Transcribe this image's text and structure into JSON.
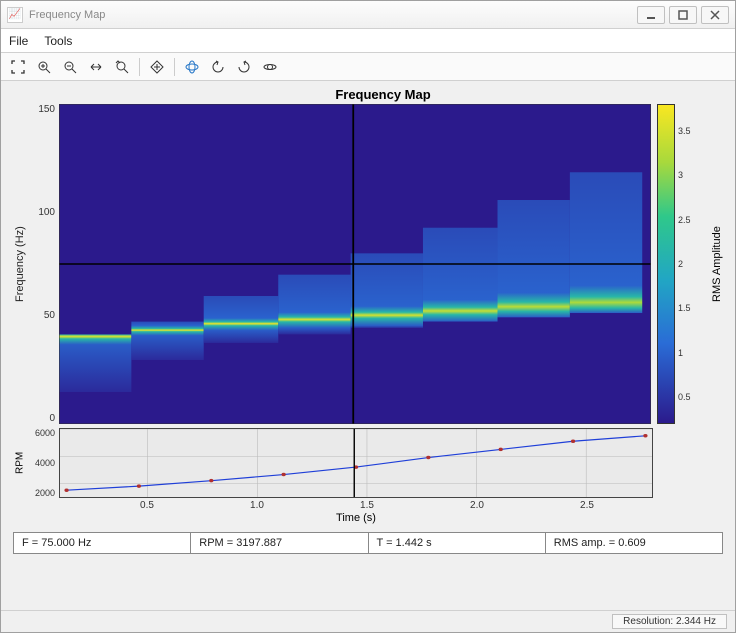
{
  "window": {
    "title": "Frequency Map",
    "min_tooltip": "Minimize",
    "max_tooltip": "Maximize",
    "close_tooltip": "Close"
  },
  "menu": {
    "file": "File",
    "tools": "Tools"
  },
  "toolbar": {
    "print": "print-icon",
    "zoom_in": "zoom-in-icon",
    "zoom_out": "zoom-out-icon",
    "pan": "pan-icon",
    "zoom_xy": "zoom-xy-icon",
    "restore": "restore-view-icon",
    "rotate3d": "rotate3d-icon",
    "go_back": "go-back-icon",
    "go_forward": "go-forward-icon",
    "link": "link-icon"
  },
  "chart_data": {
    "type": "heatmap",
    "title": "Frequency Map",
    "xlabel": "Time (s)",
    "ylabel": "Frequency (Hz)",
    "colorbar_label": "RMS Amplitude",
    "xlim": [
      0.1,
      2.8
    ],
    "ylim": [
      0,
      150
    ],
    "clim": [
      0.2,
      3.8
    ],
    "yticks": [
      0,
      50,
      100,
      150
    ],
    "colorbar_ticks": [
      0.5,
      1,
      1.5,
      2,
      2.5,
      3,
      3.5
    ],
    "crosshair": {
      "x": 1.442,
      "y": 75.0
    },
    "segments": [
      {
        "t_start": 0.1,
        "t_end": 0.43,
        "f_low": 15,
        "f_high": 42,
        "peak_f": 41,
        "peak_amp": 3.6
      },
      {
        "t_start": 0.43,
        "t_end": 0.76,
        "f_low": 30,
        "f_high": 48,
        "peak_f": 44,
        "peak_amp": 3.7
      },
      {
        "t_start": 0.76,
        "t_end": 1.1,
        "f_low": 38,
        "f_high": 60,
        "peak_f": 47,
        "peak_amp": 3.7
      },
      {
        "t_start": 1.1,
        "t_end": 1.43,
        "f_low": 42,
        "f_high": 70,
        "peak_f": 49,
        "peak_amp": 3.6
      },
      {
        "t_start": 1.43,
        "t_end": 1.76,
        "f_low": 45,
        "f_high": 80,
        "peak_f": 51,
        "peak_amp": 3.5
      },
      {
        "t_start": 1.76,
        "t_end": 2.1,
        "f_low": 48,
        "f_high": 92,
        "peak_f": 53,
        "peak_amp": 3.4
      },
      {
        "t_start": 2.1,
        "t_end": 2.43,
        "f_low": 50,
        "f_high": 105,
        "peak_f": 55,
        "peak_amp": 3.3
      },
      {
        "t_start": 2.43,
        "t_end": 2.76,
        "f_low": 52,
        "f_high": 118,
        "peak_f": 57,
        "peak_amp": 3.2
      }
    ],
    "rpm_plot": {
      "ylabel": "RPM",
      "ylim": [
        1000,
        6000
      ],
      "yticks": [
        2000,
        4000,
        6000
      ],
      "xticks": [
        0.5,
        1.0,
        1.5,
        2.0,
        2.5
      ],
      "points": [
        {
          "t": 0.13,
          "rpm": 1500
        },
        {
          "t": 0.46,
          "rpm": 1800
        },
        {
          "t": 0.79,
          "rpm": 2200
        },
        {
          "t": 1.12,
          "rpm": 2650
        },
        {
          "t": 1.45,
          "rpm": 3200
        },
        {
          "t": 1.78,
          "rpm": 3900
        },
        {
          "t": 2.11,
          "rpm": 4500
        },
        {
          "t": 2.44,
          "rpm": 5100
        },
        {
          "t": 2.77,
          "rpm": 5500
        }
      ],
      "crosshair_x": 1.442
    }
  },
  "status": {
    "f_label": "F = 75.000 Hz",
    "rpm_label": "RPM = 3197.887",
    "t_label": "T = 1.442 s",
    "rms_label": "RMS amp. = 0.609"
  },
  "footer": {
    "resolution": "Resolution: 2.344 Hz"
  },
  "colors": {
    "viridis_low": "#2b1a8c",
    "viridis_mid1": "#2a6cd6",
    "viridis_mid2": "#21c8a5",
    "viridis_high": "#f9e721"
  }
}
